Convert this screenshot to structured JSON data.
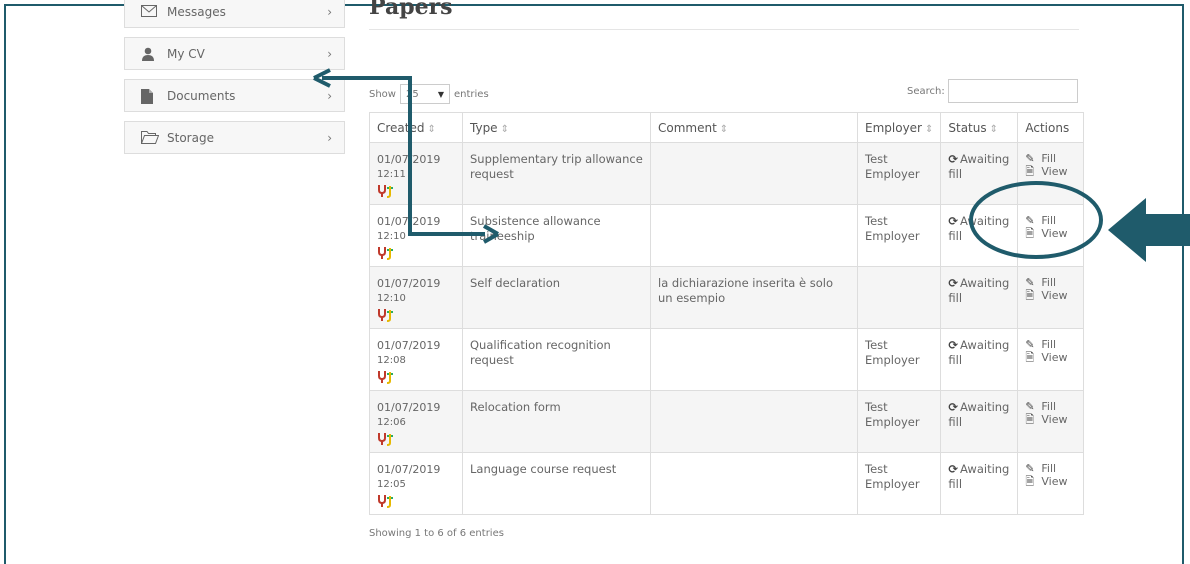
{
  "sidebar": {
    "items": [
      {
        "label": "Messages",
        "icon": "envelope-icon"
      },
      {
        "label": "My CV",
        "icon": "user-icon"
      },
      {
        "label": "Documents",
        "icon": "file-icon"
      },
      {
        "label": "Storage",
        "icon": "folder-open-icon"
      }
    ],
    "chevron": "›"
  },
  "page": {
    "title": "Papers"
  },
  "table_controls": {
    "show_label": "Show",
    "entries_value": "25",
    "entries_label": "entries",
    "search_label": "Search:"
  },
  "table": {
    "headers": [
      "Created",
      "Type",
      "Comment",
      "Employer",
      "Status",
      "Actions"
    ],
    "sort_glyph": "⇕",
    "rows": [
      {
        "date": "01/07/2019",
        "time": "12:11",
        "type": "Supplementary trip allowance request",
        "comment": "",
        "employer": "Test Employer",
        "status": "Awaiting fill"
      },
      {
        "date": "01/07/2019",
        "time": "12:10",
        "type": "Subsistence allowance traineeship",
        "comment": "",
        "employer": "Test Employer",
        "status": "Awaiting fill"
      },
      {
        "date": "01/07/2019",
        "time": "12:10",
        "type": "Self declaration",
        "comment": "la dichiarazione inserita è solo un esempio",
        "employer": "",
        "status": "Awaiting fill"
      },
      {
        "date": "01/07/2019",
        "time": "12:08",
        "type": "Qualification recognition request",
        "comment": "",
        "employer": "Test Employer",
        "status": "Awaiting fill"
      },
      {
        "date": "01/07/2019",
        "time": "12:06",
        "type": "Relocation form",
        "comment": "",
        "employer": "Test Employer",
        "status": "Awaiting fill"
      },
      {
        "date": "01/07/2019",
        "time": "12:05",
        "type": "Language course request",
        "comment": "",
        "employer": "Test Employer",
        "status": "Awaiting fill"
      }
    ],
    "fill_label": "Fill",
    "view_label": "View"
  },
  "footer": {
    "info": "Showing 1 to 6 of 6 entries"
  },
  "annotation": {
    "color": "#1f5b6b"
  }
}
